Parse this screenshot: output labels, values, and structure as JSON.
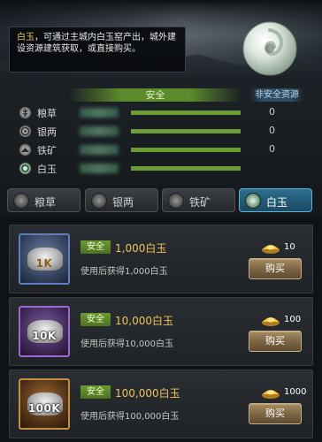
{
  "tooltip": {
    "highlight": "白玉",
    "text": "，可通过主城内白玉窑产出，城外建设资源建筑获取，或直接购买。"
  },
  "resources": {
    "safe_header": "安全",
    "unsafe_header": "非安全资源",
    "rows": [
      {
        "icon": "grain-icon",
        "name": "粮草",
        "unsafe": "0",
        "fill": 1.0
      },
      {
        "icon": "silver-icon",
        "name": "银两",
        "unsafe": "0",
        "fill": 1.0
      },
      {
        "icon": "iron-icon",
        "name": "铁矿",
        "unsafe": "0",
        "fill": 1.0
      },
      {
        "icon": "jade-icon",
        "name": "白玉",
        "unsafe": "",
        "fill": 1.0
      }
    ]
  },
  "tabs": [
    {
      "icon": "grain-icon",
      "label": "粮草",
      "active": false
    },
    {
      "icon": "silver-icon",
      "label": "银两",
      "active": false
    },
    {
      "icon": "iron-icon",
      "label": "铁矿",
      "active": false
    },
    {
      "icon": "jade-icon",
      "label": "白玉",
      "active": true
    }
  ],
  "items": [
    {
      "thumb_label": "1K",
      "tag": "安全",
      "title": "1,000白玉",
      "desc": "使用后获得1,000白玉",
      "price": "10",
      "buy": "购买"
    },
    {
      "thumb_label": "10K",
      "tag": "安全",
      "title": "10,000白玉",
      "desc": "使用后获得10,000白玉",
      "price": "100",
      "buy": "购买"
    },
    {
      "thumb_label": "100K",
      "tag": "安全",
      "title": "100,000白玉",
      "desc": "使用后获得100,000白玉",
      "price": "1000",
      "buy": "购买"
    }
  ],
  "colors": {
    "safe_green": "#6c9c36",
    "gold_text": "#f0c25a",
    "active_tab": "#2e6f8e"
  }
}
